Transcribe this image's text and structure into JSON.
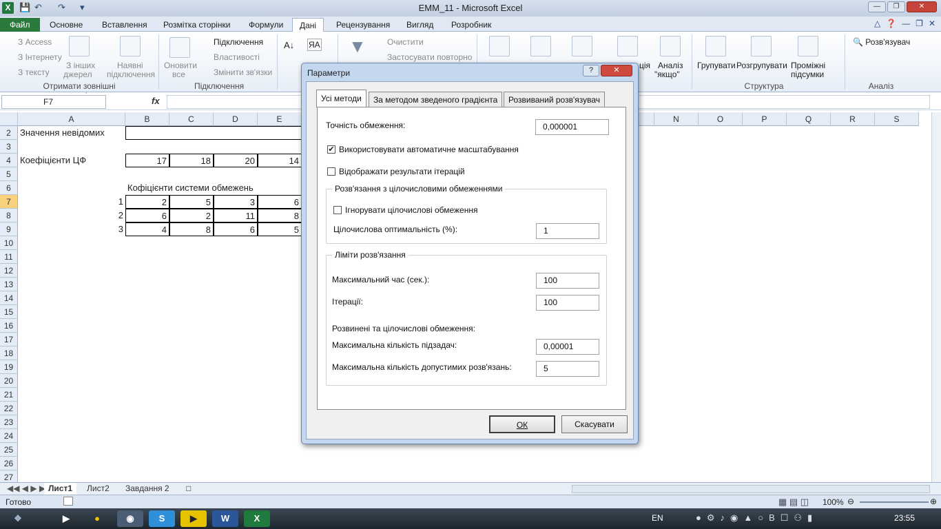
{
  "window": {
    "title": "ЕММ_11  -  Microsoft Excel",
    "app_icon": "excel-icon"
  },
  "quick_access": [
    "save-icon",
    "undo-icon",
    "redo-icon",
    "customize-icon"
  ],
  "tabs": [
    {
      "label": "Файл"
    },
    {
      "label": "Основне"
    },
    {
      "label": "Вставлення"
    },
    {
      "label": "Розмітка сторінки"
    },
    {
      "label": "Формули"
    },
    {
      "label": "Дані"
    },
    {
      "label": "Рецензування"
    },
    {
      "label": "Вигляд"
    },
    {
      "label": "Розробник"
    }
  ],
  "ribbon": {
    "get_external": {
      "access": "З Access",
      "web": "З Інтернету",
      "text": "З тексту",
      "other_1": "З інших",
      "other_2": "джерел",
      "existing_1": "Наявні",
      "existing_2": "підключення",
      "group": "Отримати зовнішні дані"
    },
    "connections": {
      "refresh_1": "Оновити",
      "refresh_2": "все",
      "connections": "Підключення",
      "properties": "Властивості",
      "edit_links": "Змінити зв'язки",
      "group": "Підключення"
    },
    "sort_filter": {
      "clear": "Очистити",
      "reapply": "Застосувати повторно"
    },
    "data_tools": {
      "whatif_prefix": "ція",
      "whatif_1": "Аналіз",
      "whatif_2": "\"якщо\""
    },
    "outline": {
      "group_btn": "Групувати",
      "ungroup": "Розгрупувати",
      "subtotal_1": "Проміжні",
      "subtotal_2": "підсумки",
      "group": "Структура"
    },
    "analysis": {
      "solver": "Розв'язувач",
      "group": "Аналіз"
    }
  },
  "formula_bar": {
    "name_box": "F7",
    "fx": "fx",
    "formula": ""
  },
  "grid": {
    "columns_left": [
      "A",
      "B",
      "C",
      "D",
      "E"
    ],
    "columns_right": [
      "N",
      "O",
      "P",
      "Q",
      "R",
      "S"
    ],
    "rows": [
      "2",
      "3",
      "4",
      "5",
      "6",
      "7",
      "8",
      "9",
      "10",
      "11",
      "12",
      "13",
      "14",
      "15",
      "16",
      "17",
      "18",
      "19",
      "20",
      "21",
      "22",
      "23",
      "24",
      "25",
      "26",
      "27"
    ],
    "cells": {
      "a2": "Значення невідомих",
      "a4": "Коефіцієнти ЦФ",
      "b4": "17",
      "c4": "18",
      "d4": "20",
      "e4": "14",
      "b6": "Кофіцієнти системи обмежень",
      "a7": "1",
      "b7": "2",
      "c7": "5",
      "d7": "3",
      "e7": "6",
      "a8": "2",
      "b8": "6",
      "c8": "2",
      "d8": "11",
      "e8": "8",
      "a9": "3",
      "b9": "4",
      "c9": "8",
      "d9": "6",
      "e9": "5"
    }
  },
  "sheet_tabs": [
    {
      "label": "Лист1"
    },
    {
      "label": "Лист2"
    },
    {
      "label": "Завдання 2"
    }
  ],
  "status": {
    "ready": "Готово",
    "zoom": "100%"
  },
  "taskbar": {
    "lang": "EN",
    "time": "23:55"
  },
  "dialog": {
    "title": "Параметри",
    "help": "?",
    "close": "✕",
    "tabs": [
      {
        "label": "Усі методи"
      },
      {
        "label": "За методом зведеного градієнта"
      },
      {
        "label": "Розвиваний розв'язувач"
      }
    ],
    "precision_label": "Точність обмеження:",
    "precision_value": "0,000001",
    "auto_scale_label": "Використовувати автоматичне масштабування",
    "auto_scale_checked": true,
    "show_iter_label": "Відображати результати ітерацій",
    "show_iter_checked": false,
    "integer_group": "Розв'язання з цілочисловими обмеженнями",
    "ignore_int_label": "Ігнорувати цілочислові обмеження",
    "ignore_int_checked": false,
    "int_opt_label": "Цілочислова оптимальність (%):",
    "int_opt_value": "1",
    "limits_group": "Ліміти розв'язання",
    "max_time_label": "Максимальний час (сек.):",
    "max_time_value": "100",
    "iterations_label": "Ітерації:",
    "iterations_value": "100",
    "evolving_label": "Розвинені та цілочислові обмеження:",
    "max_subproblems_label": "Максимальна кількість підзадач:",
    "max_subproblems_value": "0,00001",
    "max_feasible_label": "Максимальна кількість допустимих розв'язань:",
    "max_feasible_value": "5",
    "ok": "ОК",
    "cancel": "Скасувати"
  }
}
